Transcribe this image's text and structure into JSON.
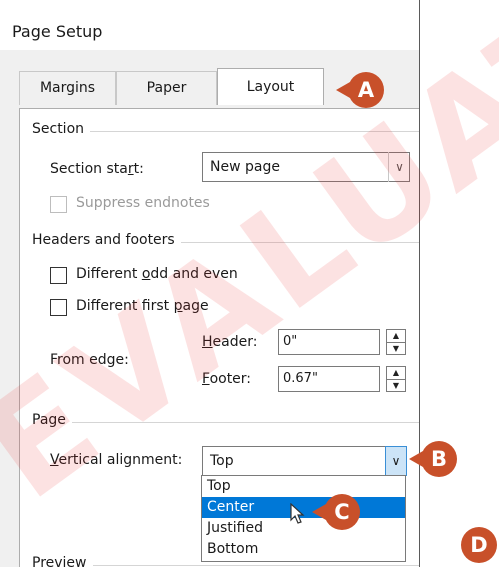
{
  "window": {
    "title": "Page Setup"
  },
  "tabs": [
    {
      "label": "Margins"
    },
    {
      "label": "Paper"
    },
    {
      "label": "Layout"
    }
  ],
  "section": {
    "heading": "Section",
    "start_label_pre": "Section sta",
    "start_label_u": "r",
    "start_label_post": "t:",
    "start_value": "New page",
    "suppress_label": "Suppress endnotes"
  },
  "headers_footers": {
    "heading": "Headers and footers",
    "odd_even_pre": "Different ",
    "odd_even_u": "o",
    "odd_even_post": "dd and even",
    "first_page_pre": "Different first ",
    "first_page_u": "p",
    "first_page_post": "age",
    "from_edge_label": "From edge:",
    "header_u": "H",
    "header_rest": "eader:",
    "header_value": "0\"",
    "footer_u": "F",
    "footer_rest": "ooter:",
    "footer_value": "0.67\""
  },
  "page": {
    "heading": "Page",
    "valign_u": "V",
    "valign_rest": "ertical alignment:",
    "valign_value": "Top",
    "options": [
      "Top",
      "Center",
      "Justified",
      "Bottom"
    ],
    "selected_option": "Center"
  },
  "preview": {
    "heading": "Preview"
  },
  "callouts": {
    "a": "A",
    "b": "B",
    "c": "C",
    "d": "D"
  },
  "colors": {
    "callout": "#c8502a",
    "selection": "#0078d7",
    "watermark": "#ef2a2a"
  },
  "watermark": {
    "text": "EVALUATION"
  }
}
